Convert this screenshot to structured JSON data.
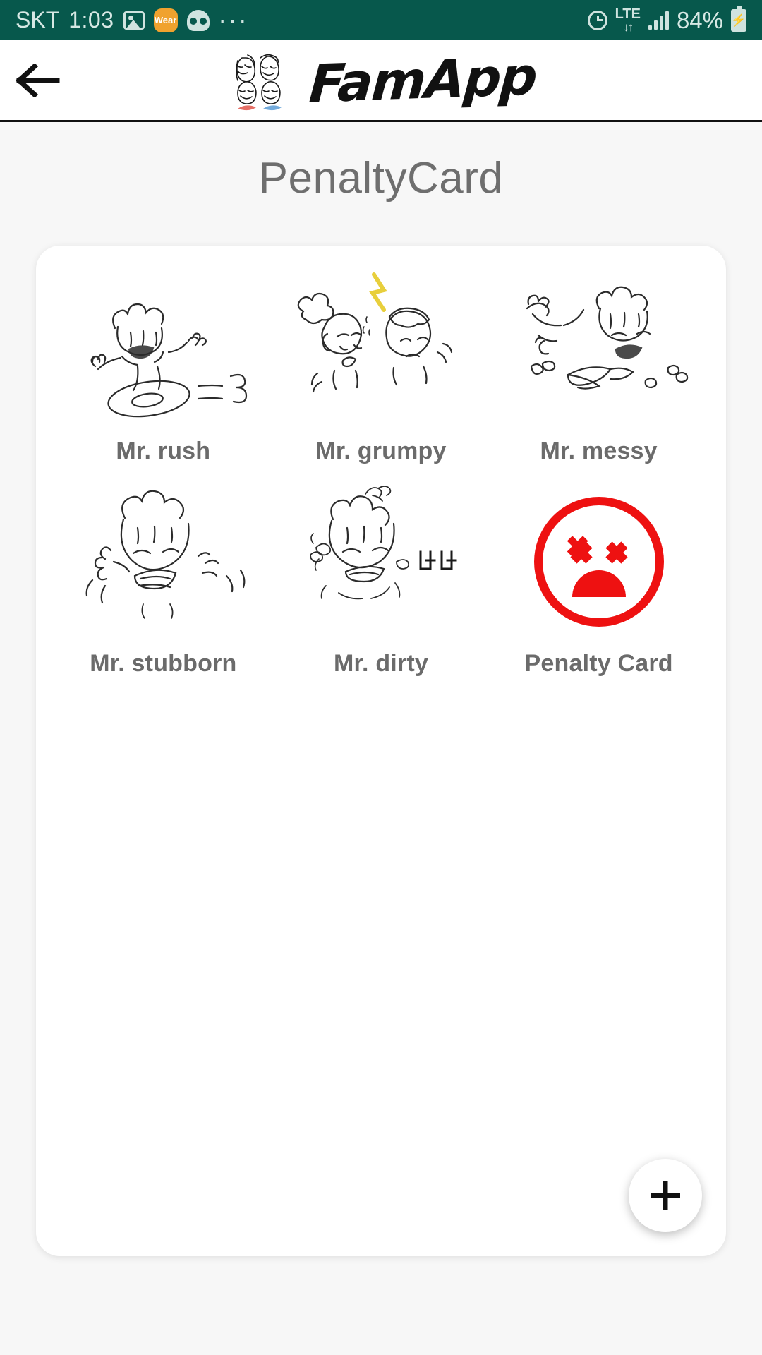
{
  "statusbar": {
    "carrier": "SKT",
    "time": "1:03",
    "wear_label": "Wear",
    "dots": "···",
    "network": "LTE",
    "network_arrows": "↓↑",
    "battery_percent": "84%",
    "icons": [
      "photo-icon",
      "wear-badge-icon",
      "skull-icon",
      "overflow-dots-icon",
      "alarm-icon",
      "lte-icon",
      "signal-bars-icon",
      "battery-charging-icon"
    ],
    "background_color": "#07584c",
    "foreground_color": "#cfe3df"
  },
  "header": {
    "back_label": "←",
    "logo_text": "FamApp",
    "logo_image_alt": "family-doodle-logo"
  },
  "page": {
    "title": "PenaltyCard"
  },
  "cards": [
    {
      "label": "Mr. rush",
      "art": "doodle-kid-hula-hoop"
    },
    {
      "label": "Mr. grumpy",
      "art": "doodle-two-kids-arguing"
    },
    {
      "label": "Mr. messy",
      "art": "doodle-kid-throwing-book"
    },
    {
      "label": "Mr. stubborn",
      "art": "doodle-kid-crying-stomping"
    },
    {
      "label": "Mr. dirty",
      "art": "doodle-kid-with-flies"
    },
    {
      "label": "Penalty Card",
      "art": "red-dead-face-icon"
    }
  ],
  "fab": {
    "label": "+",
    "name": "add-penalty-card-button"
  },
  "colors": {
    "status_bar": "#07584c",
    "title_gray": "#6e6e6e",
    "label_gray": "#6b6b6b",
    "penalty_red": "#ee1111",
    "page_bg": "#f7f7f7",
    "card_bg": "#ffffff"
  }
}
